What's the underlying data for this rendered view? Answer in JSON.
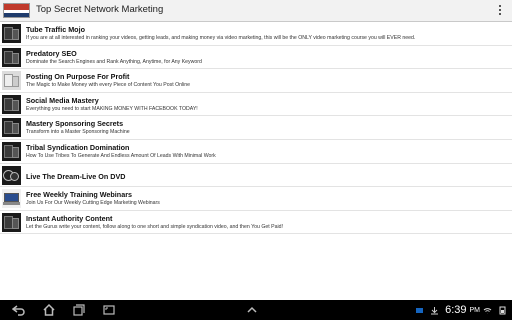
{
  "app": {
    "title": "Top Secret Network  Marketing"
  },
  "items": [
    {
      "title": "Tube Traffic Mojo",
      "desc": "If you are at all interested in ranking your videos, getting leads, and making money via video marketing, this will be the ONLY video marketing course you will EVER need."
    },
    {
      "title": "Predatory SEO",
      "desc": "Dominate the Search Engines and Rank Anything, Anytime, for Any Keyword"
    },
    {
      "title": "Posting On Purpose For Profit",
      "desc": "The Magic to Make Money with every Piece of Content You Post Online"
    },
    {
      "title": "Social Media Mastery",
      "desc": "Everything you need to start MAKING MONEY WITH FACEBOOK TODAY!"
    },
    {
      "title": "Mastery Sponsoring Secrets",
      "desc": "Transform into a Master Sponsoring Machine"
    },
    {
      "title": "Tribal Syndication Domination",
      "desc": "How To Use Tribes To Generate And Endless Amount Of Leads With Minimal Work"
    },
    {
      "title": "Live The Dream-Live On DVD",
      "desc": ""
    },
    {
      "title": "Free Weekly Training Webinars",
      "desc": "Join Us For Our Weekly Cutting Edge Marketing Webinars"
    },
    {
      "title": "Instant Authority Content",
      "desc": "Let the Gurus write your content, follow along to one short and simple syndication video, and then You Get Paid!"
    }
  ],
  "status": {
    "time": "6:39",
    "ampm": "PM"
  }
}
